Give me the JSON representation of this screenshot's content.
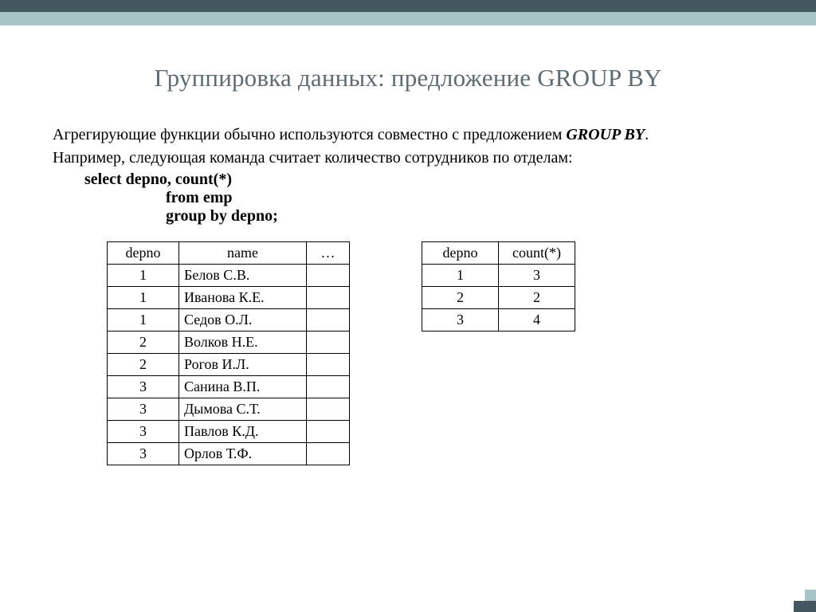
{
  "title": "Группировка данных: предложение GROUP BY",
  "para1_a": "Агрегирующие функции обычно используются совместно с предложением ",
  "para1_b": "GROUP BY",
  "para1_c": ".",
  "para2": "Например, следующая команда считает количество сотрудников по отделам:",
  "sql": {
    "l1": "select  depno,  count(*)",
    "l2": "from emp",
    "l3": "group by depno;"
  },
  "emp_table": {
    "headers": [
      "depno",
      "name",
      "…"
    ],
    "rows": [
      [
        "1",
        "Белов С.В.",
        ""
      ],
      [
        "1",
        "Иванова К.Е.",
        ""
      ],
      [
        "1",
        "Седов О.Л.",
        ""
      ],
      [
        "2",
        "Волков Н.Е.",
        ""
      ],
      [
        "2",
        "Рогов И.Л.",
        ""
      ],
      [
        "3",
        "Санина В.П.",
        ""
      ],
      [
        "3",
        "Дымова С.Т.",
        ""
      ],
      [
        "3",
        "Павлов К.Д.",
        ""
      ],
      [
        "3",
        "Орлов Т.Ф.",
        ""
      ]
    ]
  },
  "result_table": {
    "headers": [
      "depno",
      "count(*)"
    ],
    "rows": [
      [
        "1",
        "3"
      ],
      [
        "2",
        "2"
      ],
      [
        "3",
        "4"
      ]
    ]
  }
}
